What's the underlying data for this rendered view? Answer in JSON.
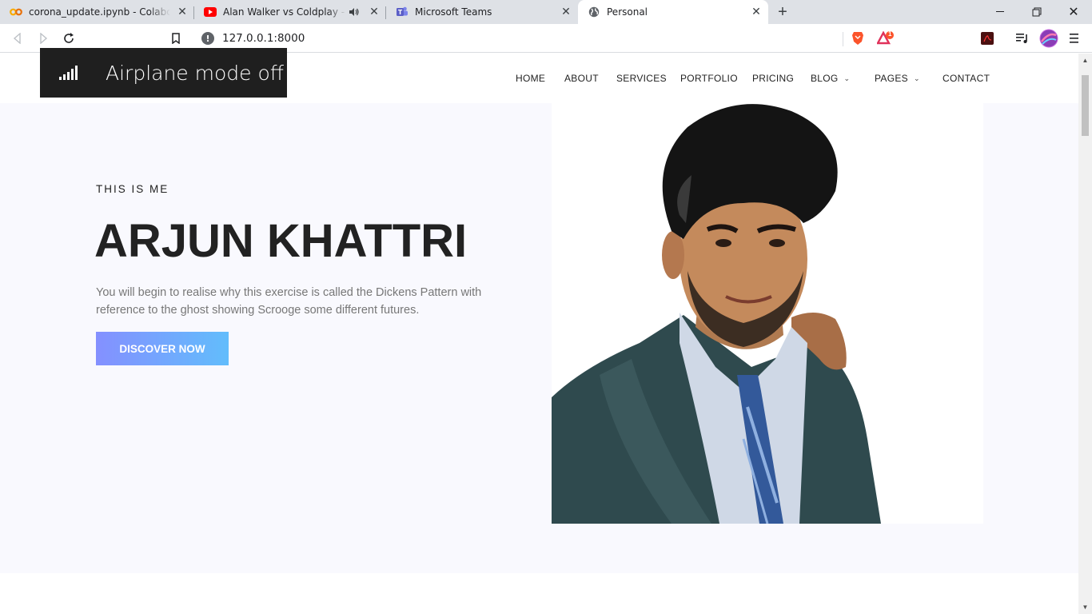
{
  "browser": {
    "tabs": [
      {
        "title": "corona_update.ipynb - Colaboratory",
        "favicon": "colab-icon"
      },
      {
        "title": "Alan Walker vs Coldplay - Hymn For The Weekend",
        "favicon": "youtube-icon"
      },
      {
        "title": "Microsoft Teams",
        "favicon": "teams-icon"
      },
      {
        "title": "Personal",
        "favicon": "globe-icon",
        "active": true
      }
    ],
    "url": "127.0.0.1:8000",
    "brave_badge_count": "1",
    "colors": {
      "tabstrip": "#dee1e6",
      "youtube": "#ff0000",
      "teams": "#5b5fc7"
    }
  },
  "overlay": {
    "title": "Airplane mode off",
    "icon": "signal-bars-icon"
  },
  "nav": {
    "items": [
      {
        "label": "HOME"
      },
      {
        "label": "ABOUT"
      },
      {
        "label": "SERVICES"
      },
      {
        "label": "PORTFOLIO"
      },
      {
        "label": "PRICING"
      },
      {
        "label": "BLOG",
        "dropdown": true
      },
      {
        "label": "PAGES",
        "dropdown": true
      },
      {
        "label": "CONTACT"
      }
    ]
  },
  "hero": {
    "subtitle": "THIS IS ME",
    "name": "ARJUN KHATTRI",
    "description": "You will begin to realise why this exercise is called the Dickens Pattern with reference to the ghost showing Scrooge some different futures.",
    "cta_label": "DISCOVER NOW",
    "cta_gradient": [
      "#8490ff",
      "#62bdfc"
    ],
    "background": "#f9f9fe"
  }
}
